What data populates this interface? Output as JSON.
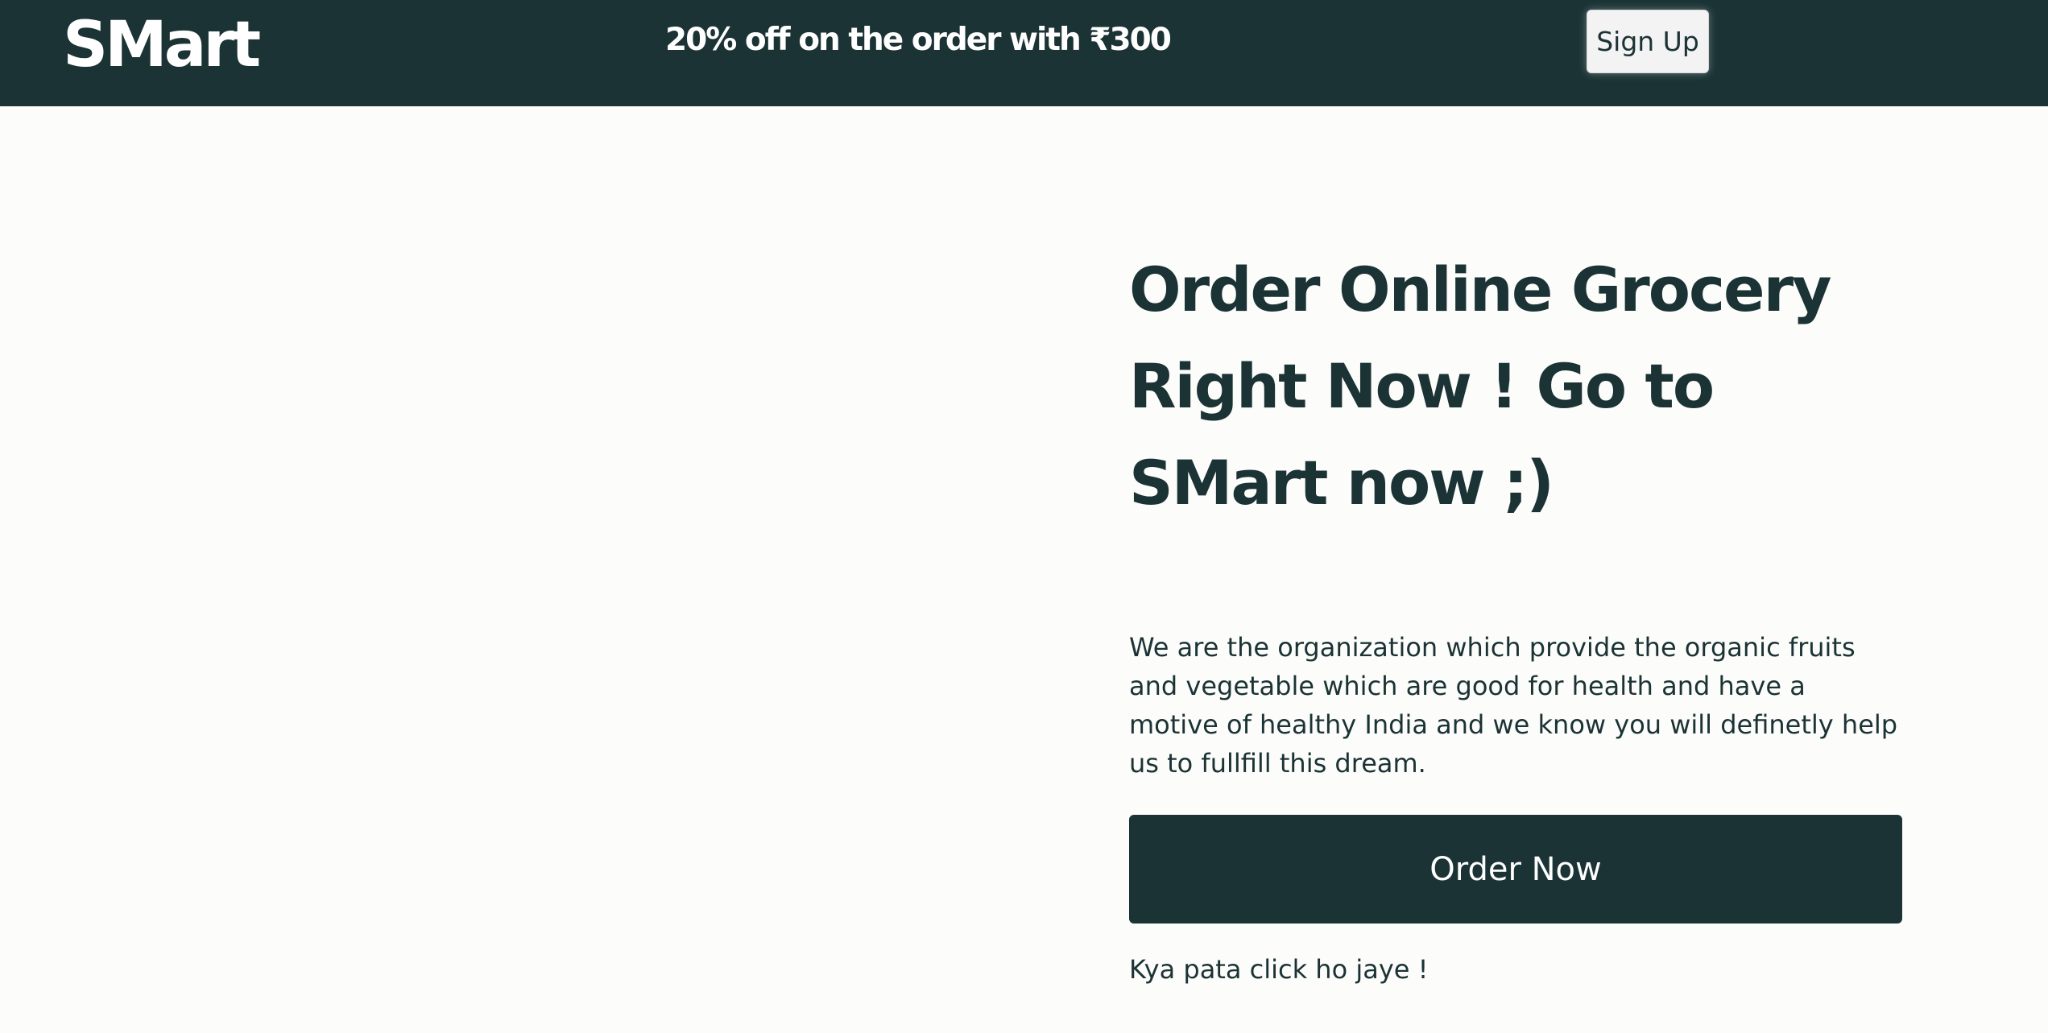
{
  "header": {
    "logo": "SMart",
    "promo": "20% off on the order with ₹300",
    "signup_label": "Sign Up"
  },
  "hero": {
    "title": "Order Online Grocery Right Now ! Go to SMart now ;)",
    "description": "We are the organization which provide the organic fruits and vegetable which are good for health and have a motive of healthy India and we know you will definetly help us to fullfill this dream.",
    "order_label": "Order Now",
    "hint": "Kya pata click ho jaye !"
  },
  "colors": {
    "primary": "#1b3335",
    "background": "#fcfcfa",
    "button_light": "#f3f3f3"
  }
}
